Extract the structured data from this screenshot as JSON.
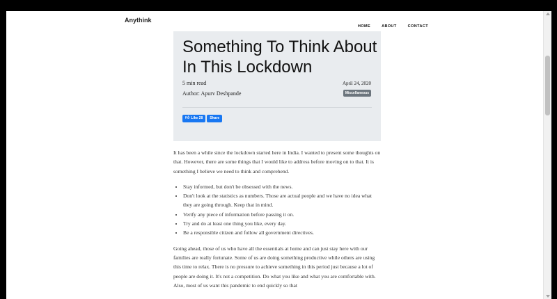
{
  "navbar": {
    "brand": "Anythink",
    "links": [
      "HOME",
      "ABOUT",
      "CONTACT"
    ]
  },
  "post": {
    "title": "Something To Think About In This Lockdown",
    "read_time": "5 min read",
    "date": "April 24, 2020",
    "author": "Author: Apurv Deshpande",
    "category": "Miscellaneous",
    "like_label": "Like 28",
    "share_label": "Share"
  },
  "body": {
    "intro": "It has been a while since the lockdown started here in India. I wanted to present some thoughts on that. However, there are some things that I would like to address before moving on to that. It is something I believe we need to think and comprehend.",
    "bullets": [
      "Stay informed, but don't be obsessed with the news.",
      "Don't look at the statistics as numbers. Those are actual people and we have no idea what they are going through. Keep that in mind.",
      "Verify any piece of information before passing it on.",
      "Try and do at least one thing you like, every day.",
      "Be a responsible citizen and follow all government directives."
    ],
    "para2": "Going ahead, those of us who have all the essentials at home and can just stay here with our families are really fortunate. Some of us are doing something productive while others are using this time to relax. There is no pressure to achieve something in this period just because a lot of people are doing it. It's not a competition. Do what you like and what you are comfortable with. Also, most of us want this pandemic to end quickly so that"
  },
  "icons": {
    "like": "thumbs-up-icon"
  },
  "colors": {
    "header_bg": "#e9ecef",
    "badge_bg": "#6c757d",
    "facebook_blue": "#1877f2"
  }
}
